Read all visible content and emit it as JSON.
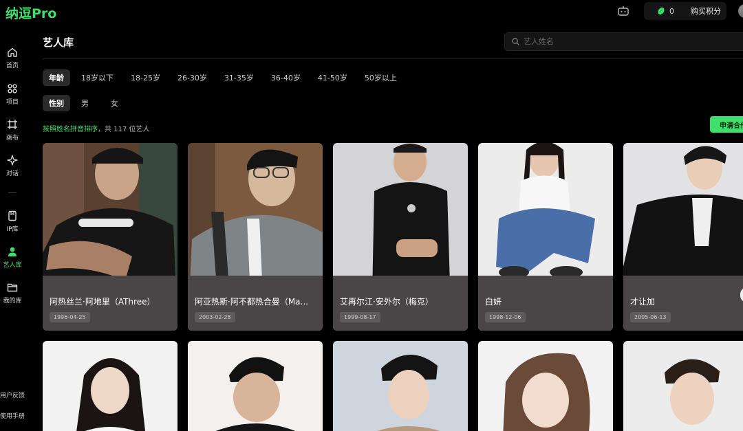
{
  "app": {
    "logo": "纳逗Pro"
  },
  "topbar": {
    "points_count": "0",
    "buy_label": "购买积分",
    "icons": [
      "robot-icon",
      "bean-icon",
      "avatar"
    ]
  },
  "sidebar": {
    "items": [
      {
        "label": "首页",
        "icon": "home-icon"
      },
      {
        "label": "项目",
        "icon": "grid-icon"
      },
      {
        "label": "画布",
        "icon": "canvas-icon"
      },
      {
        "label": "对话",
        "icon": "sparkle-icon"
      },
      {
        "label": "IP库",
        "icon": "bookmark-icon"
      },
      {
        "label": "艺人库",
        "icon": "person-icon",
        "active": true
      },
      {
        "label": "我的库",
        "icon": "folder-icon"
      }
    ],
    "feedback": "用户反馈",
    "manual": "使用手册"
  },
  "header": {
    "title": "艺人库",
    "search_placeholder": "艺人姓名"
  },
  "filters": {
    "age": {
      "label": "年龄",
      "options": [
        "18岁以下",
        "18-25岁",
        "26-30岁",
        "31-35岁",
        "36-40岁",
        "41-50岁",
        "50岁以上"
      ]
    },
    "gender": {
      "label": "性别",
      "options": [
        "男",
        "女"
      ]
    }
  },
  "summary": {
    "sort_text": "按照姓名拼音排序，",
    "count_text": "共 117 位艺人"
  },
  "apply_button": "申请合作",
  "artists": [
    {
      "name": "阿热丝兰·阿地里（AThree）",
      "date": "1996-04-25"
    },
    {
      "name": "阿亚热斯·阿不都热合曼（Ma...",
      "date": "2003-02-28"
    },
    {
      "name": "艾再尔江·安外尔（梅克）",
      "date": "1999-08-17"
    },
    {
      "name": "白妍",
      "date": "1998-12-06"
    },
    {
      "name": "才让加",
      "date": "2005-06-13"
    }
  ],
  "colors": {
    "accent": "#3ee06a",
    "background": "#000000",
    "card_footer": "#4a4648"
  }
}
